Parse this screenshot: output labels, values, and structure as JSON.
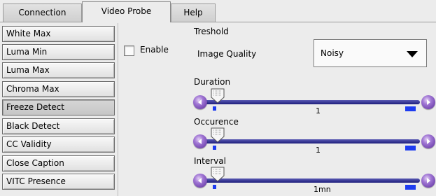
{
  "tabs": [
    {
      "label": "Connection"
    },
    {
      "label": "Video Probe"
    },
    {
      "label": "Help"
    }
  ],
  "active_tab": "Video Probe",
  "sidebar": {
    "items": [
      {
        "label": "White Max"
      },
      {
        "label": "Luma Min"
      },
      {
        "label": "Luma Max"
      },
      {
        "label": "Chroma Max"
      },
      {
        "label": "Freeze Detect"
      },
      {
        "label": "Black Detect"
      },
      {
        "label": "CC Validity"
      },
      {
        "label": "Close Caption"
      },
      {
        "label": "VITC Presence"
      }
    ],
    "selected": "Freeze Detect"
  },
  "enable": {
    "label": "Enable",
    "checked": false
  },
  "threshold": {
    "heading": "Treshold"
  },
  "image_quality": {
    "label": "Image Quality",
    "value": "Noisy"
  },
  "sliders": [
    {
      "label": "Duration",
      "value": "1"
    },
    {
      "label": "Occurence",
      "value": "1"
    },
    {
      "label": "Interval",
      "value": "1mn"
    }
  ],
  "colors": {
    "track": "#1e1e7c",
    "marker": "#1e3cf0",
    "knob": "#8a5cc8"
  },
  "icons": {
    "left_knob": "arrow-left-icon",
    "right_knob": "arrow-right-icon",
    "thumb": "slider-thumb-icon",
    "dropdown": "triangle-down-icon"
  }
}
